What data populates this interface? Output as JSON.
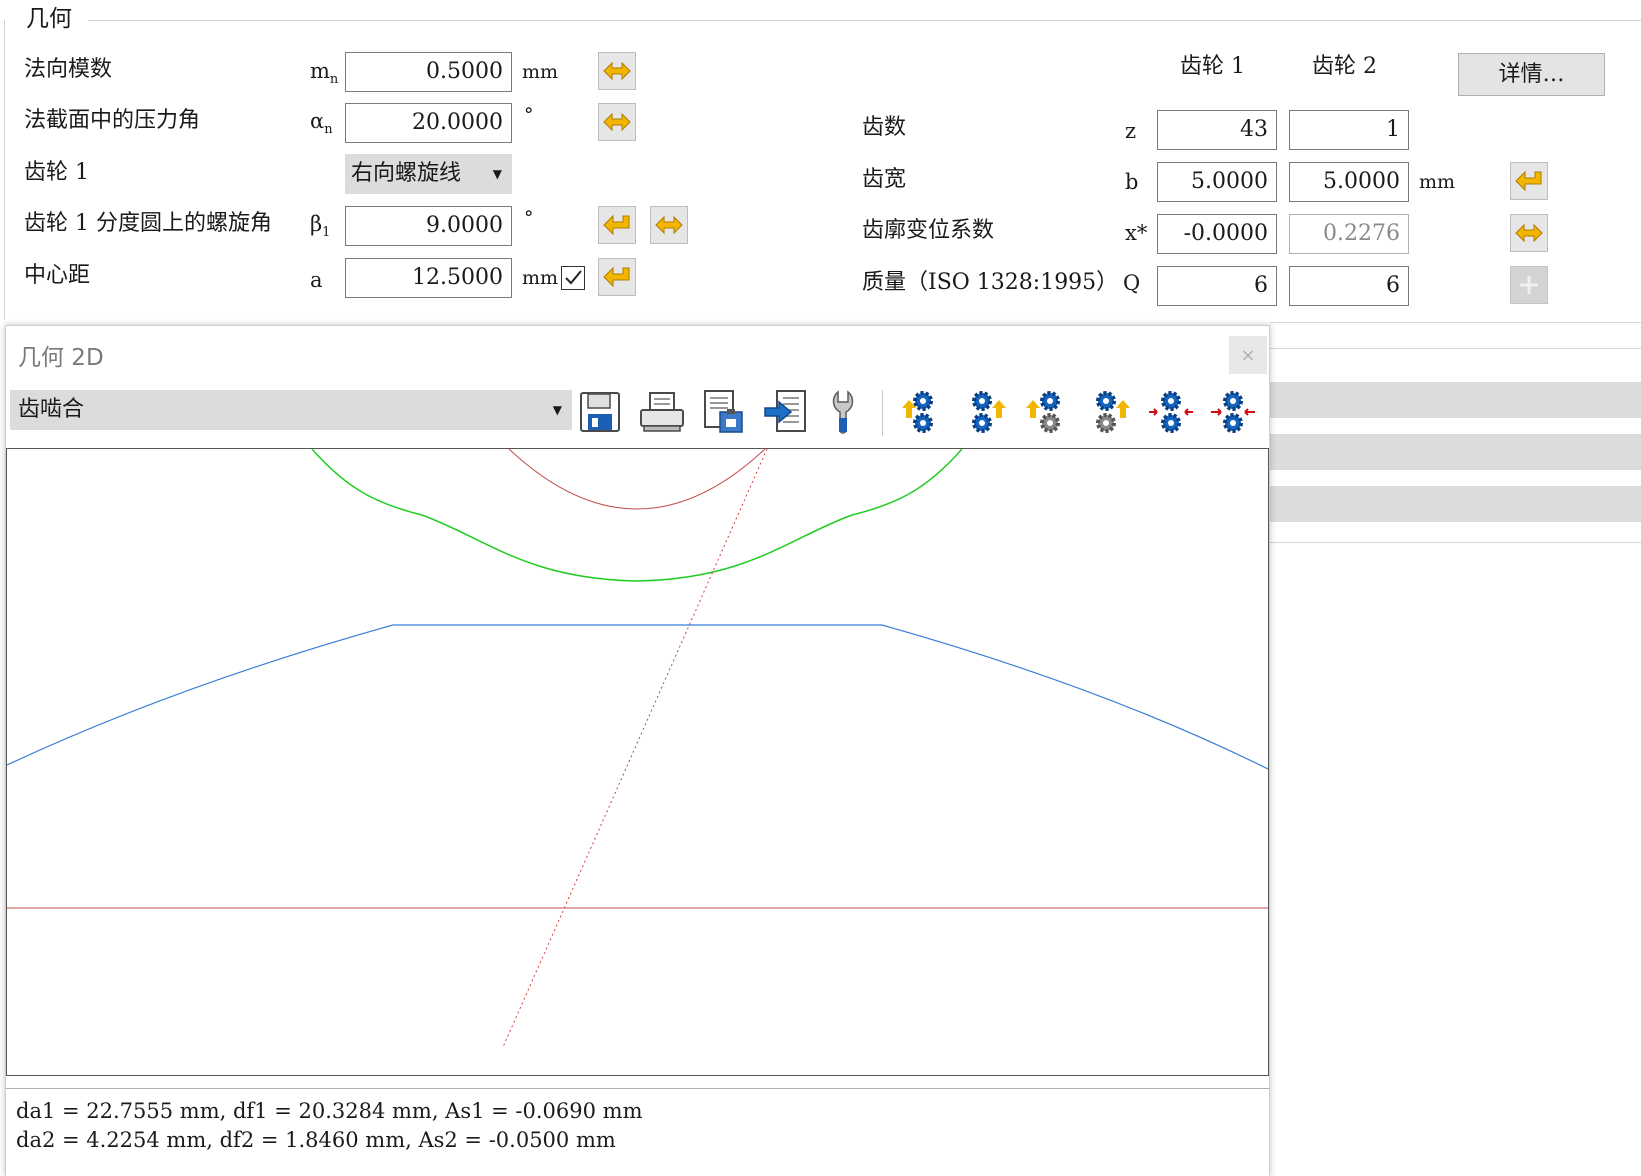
{
  "group": {
    "title": "几何"
  },
  "left": {
    "rows": [
      {
        "label": "法向模数",
        "symbol": "m",
        "symbol_sub": "n",
        "value": "0.5000",
        "unit": "mm"
      },
      {
        "label": "法截面中的压力角",
        "symbol": "α",
        "symbol_sub": "n",
        "value": "20.0000",
        "unit": "°"
      },
      {
        "label": "齿轮 1",
        "select_value": "右向螺旋线"
      },
      {
        "label": "齿轮 1 分度圆上的螺旋角",
        "symbol": "β",
        "symbol_sub": "1",
        "value": "9.0000",
        "unit": "°"
      },
      {
        "label": "中心距",
        "symbol": "a",
        "value": "12.5000",
        "unit": "mm"
      }
    ]
  },
  "right": {
    "col_headers": [
      "齿轮 1",
      "齿轮 2"
    ],
    "details_button": "详情…",
    "rows": [
      {
        "label": "齿数",
        "symbol": "z",
        "v1": "43",
        "v2": "1",
        "unit": ""
      },
      {
        "label": "齿宽",
        "symbol": "b",
        "v1": "5.0000",
        "v2": "5.0000",
        "unit": "mm"
      },
      {
        "label": "齿廓变位系数",
        "symbol": "x*",
        "v1": "-0.0000",
        "v2": "0.2276",
        "unit": ""
      },
      {
        "label": "质量（ISO 1328:1995）",
        "symbol": "Q",
        "v1": "6",
        "v2": "6",
        "unit": ""
      }
    ]
  },
  "window": {
    "title": "几何 2D",
    "close_glyph": "×",
    "view_select": "齿啮合",
    "info_line1": "da1 = 22.7555 mm, df1 = 20.3284 mm, As1 = -0.0690 mm",
    "info_line2": "da2 = 4.2254 mm, df2 = 1.8460 mm, As2 = -0.0500 mm"
  },
  "colors": {
    "accent_arrow": "#f2b600",
    "gear_blue": "#1565c0",
    "curve_green": "#22cc22",
    "curve_blue": "#3a7fd5",
    "curve_red": "#c0504d"
  },
  "icons": [
    "save-icon",
    "print-icon",
    "clipboard-icon",
    "export-icon",
    "wrench-icon",
    "gear-view-1-icon",
    "gear-view-2-icon",
    "gear-view-3-icon",
    "gear-view-4-icon",
    "gear-zoom-in-icon",
    "gear-zoom-out-icon"
  ]
}
